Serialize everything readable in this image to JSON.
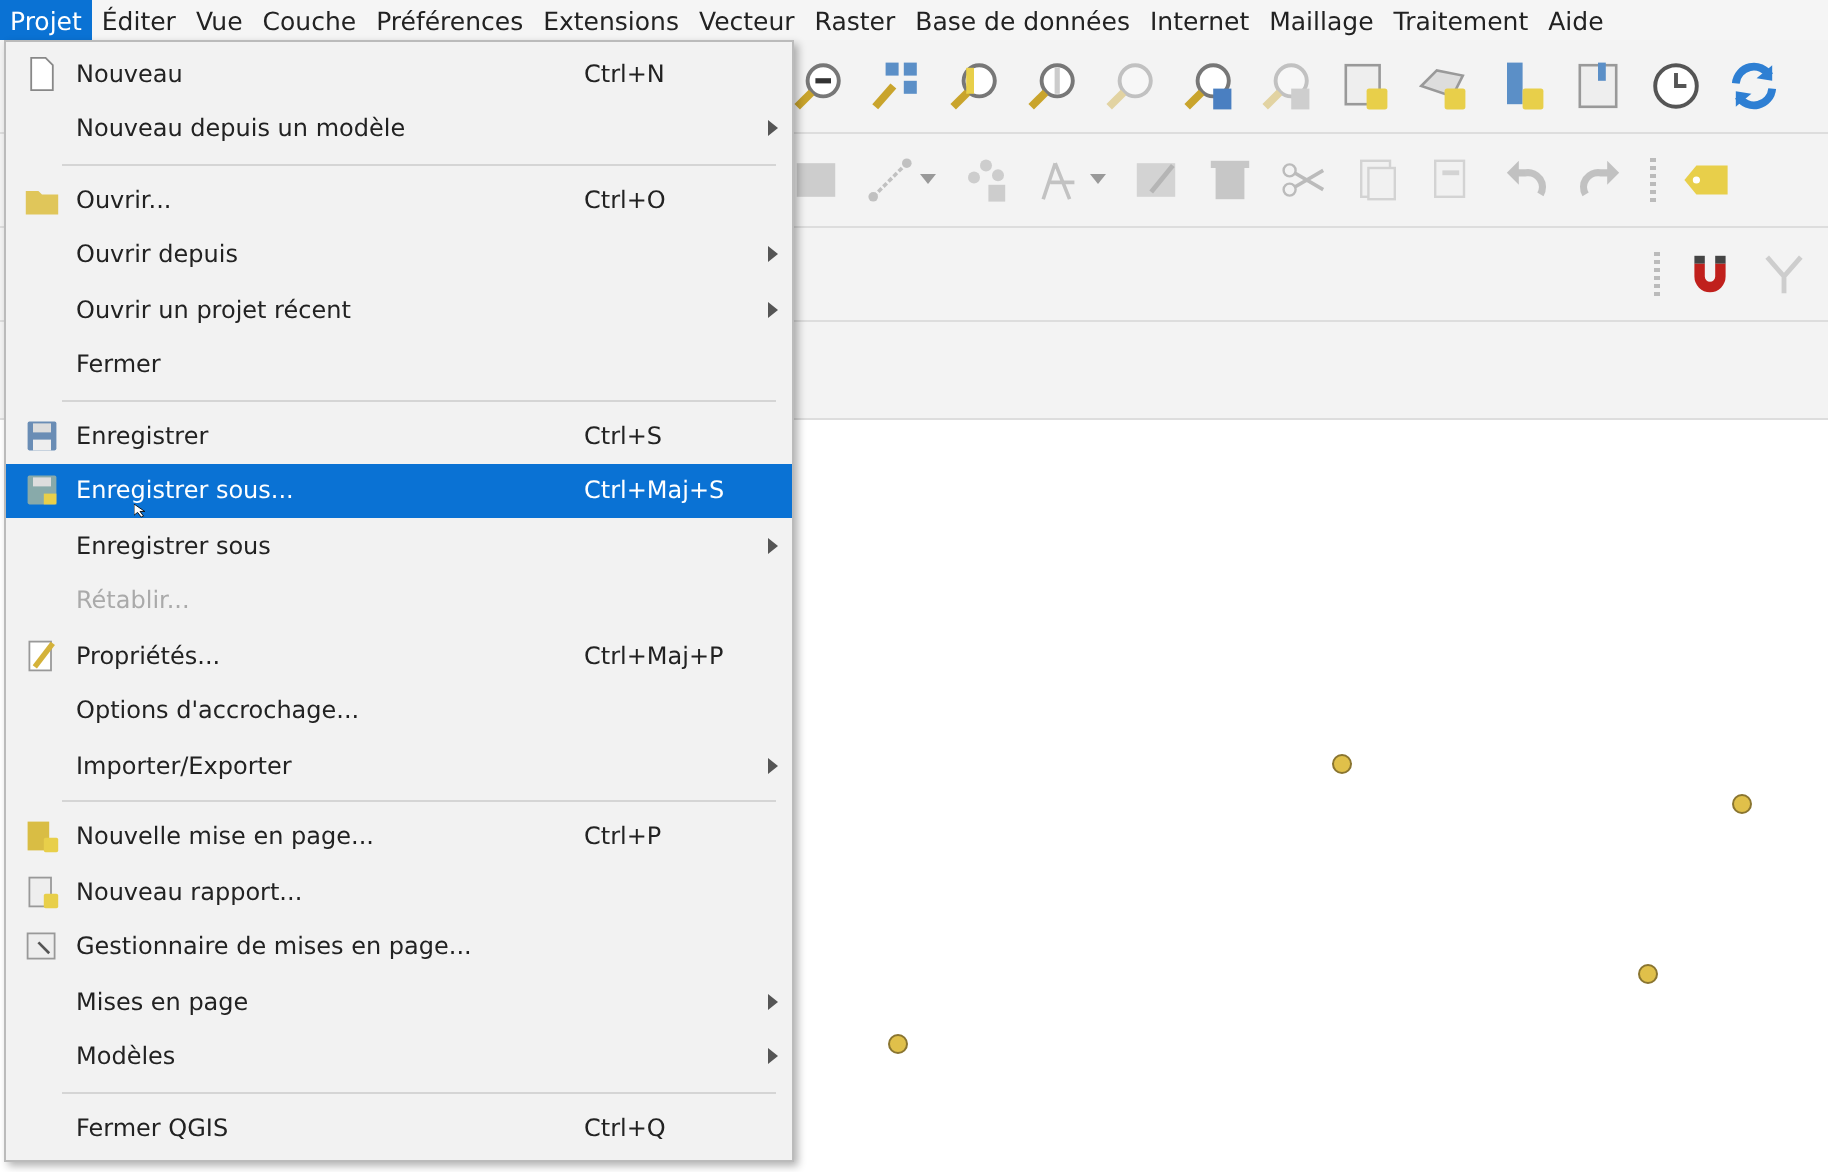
{
  "menu_bar": [
    {
      "label": "Projet",
      "selected": true
    },
    {
      "label": "Éditer",
      "selected": false
    },
    {
      "label": "Vue",
      "selected": false
    },
    {
      "label": "Couche",
      "selected": false
    },
    {
      "label": "Préférences",
      "selected": false
    },
    {
      "label": "Extensions",
      "selected": false
    },
    {
      "label": "Vecteur",
      "selected": false
    },
    {
      "label": "Raster",
      "selected": false
    },
    {
      "label": "Base de données",
      "selected": false
    },
    {
      "label": "Internet",
      "selected": false
    },
    {
      "label": "Maillage",
      "selected": false
    },
    {
      "label": "Traitement",
      "selected": false
    },
    {
      "label": "Aide",
      "selected": false
    }
  ],
  "project_menu": {
    "items": [
      {
        "kind": "item",
        "label": "Nouveau",
        "shortcut": "Ctrl+N",
        "submenu": false,
        "disabled": false,
        "selected": false
      },
      {
        "kind": "item",
        "label": "Nouveau depuis un modèle",
        "submenu": true,
        "disabled": false,
        "selected": false
      },
      {
        "kind": "separator"
      },
      {
        "kind": "item",
        "label": "Ouvrir...",
        "shortcut": "Ctrl+O",
        "submenu": false,
        "disabled": false,
        "selected": false
      },
      {
        "kind": "item",
        "label": "Ouvrir depuis",
        "submenu": true,
        "disabled": false,
        "selected": false
      },
      {
        "kind": "item",
        "label": "Ouvrir un projet récent",
        "submenu": true,
        "disabled": false,
        "selected": false
      },
      {
        "kind": "item",
        "label": "Fermer",
        "submenu": false,
        "disabled": false,
        "selected": false
      },
      {
        "kind": "separator"
      },
      {
        "kind": "item",
        "label": "Enregistrer",
        "shortcut": "Ctrl+S",
        "submenu": false,
        "disabled": false,
        "selected": false
      },
      {
        "kind": "item",
        "label": "Enregistrer sous...",
        "shortcut": "Ctrl+Maj+S",
        "submenu": false,
        "disabled": false,
        "selected": true
      },
      {
        "kind": "item",
        "label": "Enregistrer sous",
        "submenu": true,
        "disabled": false,
        "selected": false
      },
      {
        "kind": "item",
        "label": "Rétablir...",
        "submenu": false,
        "disabled": true,
        "selected": false
      },
      {
        "kind": "item",
        "label": "Propriétés...",
        "shortcut": "Ctrl+Maj+P",
        "submenu": false,
        "disabled": false,
        "selected": false
      },
      {
        "kind": "item",
        "label": "Options d'accrochage...",
        "submenu": false,
        "disabled": false,
        "selected": false
      },
      {
        "kind": "item",
        "label": "Importer/Exporter",
        "submenu": true,
        "disabled": false,
        "selected": false
      },
      {
        "kind": "separator"
      },
      {
        "kind": "item",
        "label": "Nouvelle mise en page...",
        "shortcut": "Ctrl+P",
        "submenu": false,
        "disabled": false,
        "selected": false
      },
      {
        "kind": "item",
        "label": "Nouveau rapport...",
        "submenu": false,
        "disabled": false,
        "selected": false
      },
      {
        "kind": "item",
        "label": "Gestionnaire de mises en page...",
        "submenu": false,
        "disabled": false,
        "selected": false
      },
      {
        "kind": "item",
        "label": "Mises en page",
        "submenu": true,
        "disabled": false,
        "selected": false
      },
      {
        "kind": "item",
        "label": "Modèles",
        "submenu": true,
        "disabled": false,
        "selected": false
      },
      {
        "kind": "separator"
      },
      {
        "kind": "item",
        "label": "Fermer QGIS",
        "shortcut": "Ctrl+Q",
        "submenu": false,
        "disabled": false,
        "selected": false
      }
    ]
  }
}
